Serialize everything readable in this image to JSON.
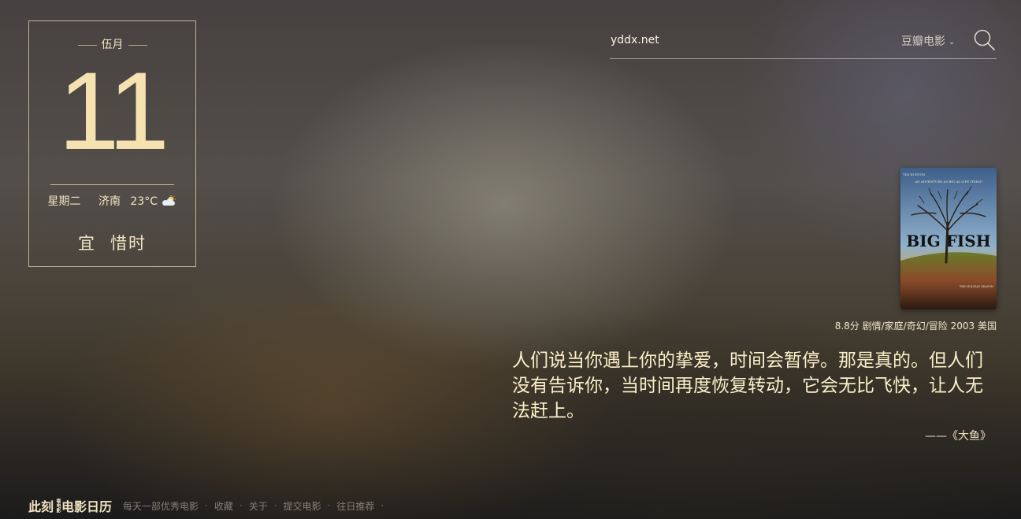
{
  "calendar": {
    "month": "伍月",
    "day": "11",
    "weekday": "星期二",
    "city": "济南",
    "temperature": "23°C",
    "weather_icon": "partly-cloudy-icon",
    "yi_label": "宜",
    "yi_value": "惜时"
  },
  "search": {
    "value": "yddx.net",
    "source_label": "豆瓣电影",
    "icon": "search-icon"
  },
  "movie": {
    "poster_title": "BIG FISH",
    "poster_tagline": "AN ADVENTURE AS BIG AS LIFE ITSELF",
    "poster_director": "TIM BURTON",
    "poster_billing": "THE HOLIDAY SEASON",
    "rating": "8.8分",
    "genres": "剧情/家庭/奇幻/冒险",
    "year": "2003",
    "country": "美国",
    "quote": "人们说当你遇上你的挚爱，时间会暂停。那是真的。但人们没有告诉你，当时间再度恢复转动，它会无比飞快，让人无法赶上。",
    "source": "——《大鱼》"
  },
  "footer": {
    "logo_left": "此刻",
    "logo_mid": "看电影",
    "logo_right": "电影日历",
    "nav": [
      {
        "label": "每天一部优秀电影"
      },
      {
        "label": "收藏"
      },
      {
        "label": "关于"
      },
      {
        "label": "提交电影"
      },
      {
        "label": "往日推荐"
      }
    ]
  },
  "colors": {
    "accent": "#f5e2b0",
    "text_light": "#fbefc9"
  }
}
